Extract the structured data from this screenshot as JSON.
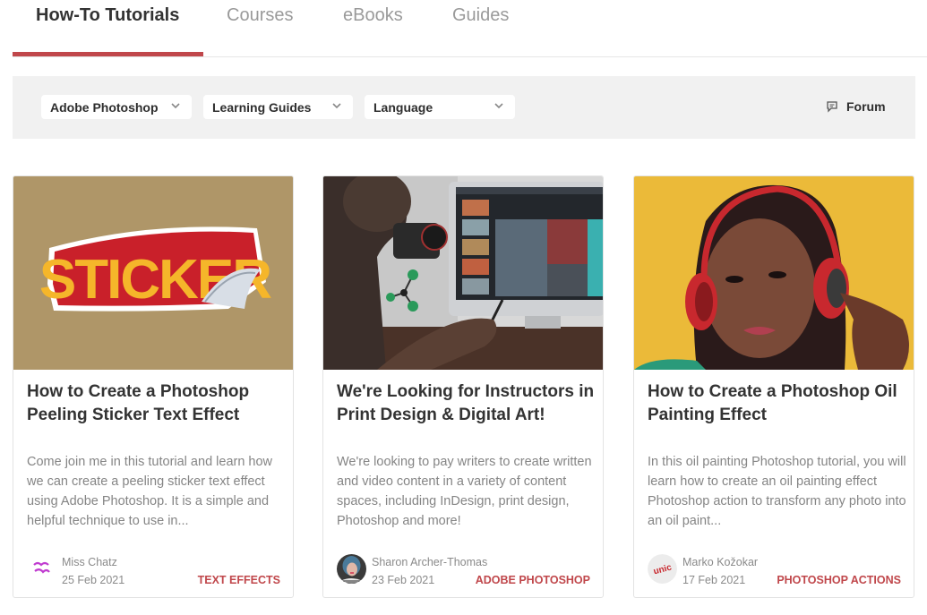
{
  "tabs": [
    {
      "label": "How-To Tutorials",
      "active": true
    },
    {
      "label": "Courses",
      "active": false
    },
    {
      "label": "eBooks",
      "active": false
    },
    {
      "label": "Guides",
      "active": false
    }
  ],
  "filters": {
    "software": {
      "selected": "Adobe Photoshop"
    },
    "type": {
      "selected": "Learning Guides"
    },
    "language": {
      "selected": "Language"
    },
    "forum_label": "Forum"
  },
  "colors": {
    "accent": "#c0474b",
    "filter_bg": "#f1f1f1"
  },
  "cards": [
    {
      "title": "How to Create a Photoshop Peeling Sticker Text Effect",
      "description": "Come join me in this tutorial and learn how we can create a peeling sticker text effect using Adobe Photoshop. It is a simple and helpful technique to use in...",
      "author": "Miss Chatz",
      "date": "25 Feb 2021",
      "category": "TEXT EFFECTS",
      "thumb_text": "STICKER"
    },
    {
      "title": "We're Looking for Instructors in Print Design & Digital Art!",
      "description": "We're looking to pay writers to create written and video content in a variety of content spaces, including InDesign, print design, Photoshop and more!",
      "author": "Sharon Archer-Thomas",
      "date": "23 Feb 2021",
      "category": "ADOBE PHOTOSHOP"
    },
    {
      "title": "How to Create a Photoshop Oil Painting Effect",
      "description": "In this oil painting Photoshop tutorial, you will learn how to create an oil painting effect Photoshop action to transform any photo into an oil paint...",
      "author": "Marko Kožokar",
      "date": "17 Feb 2021",
      "category": "PHOTOSHOP ACTIONS",
      "avatar_text": "unic"
    }
  ]
}
